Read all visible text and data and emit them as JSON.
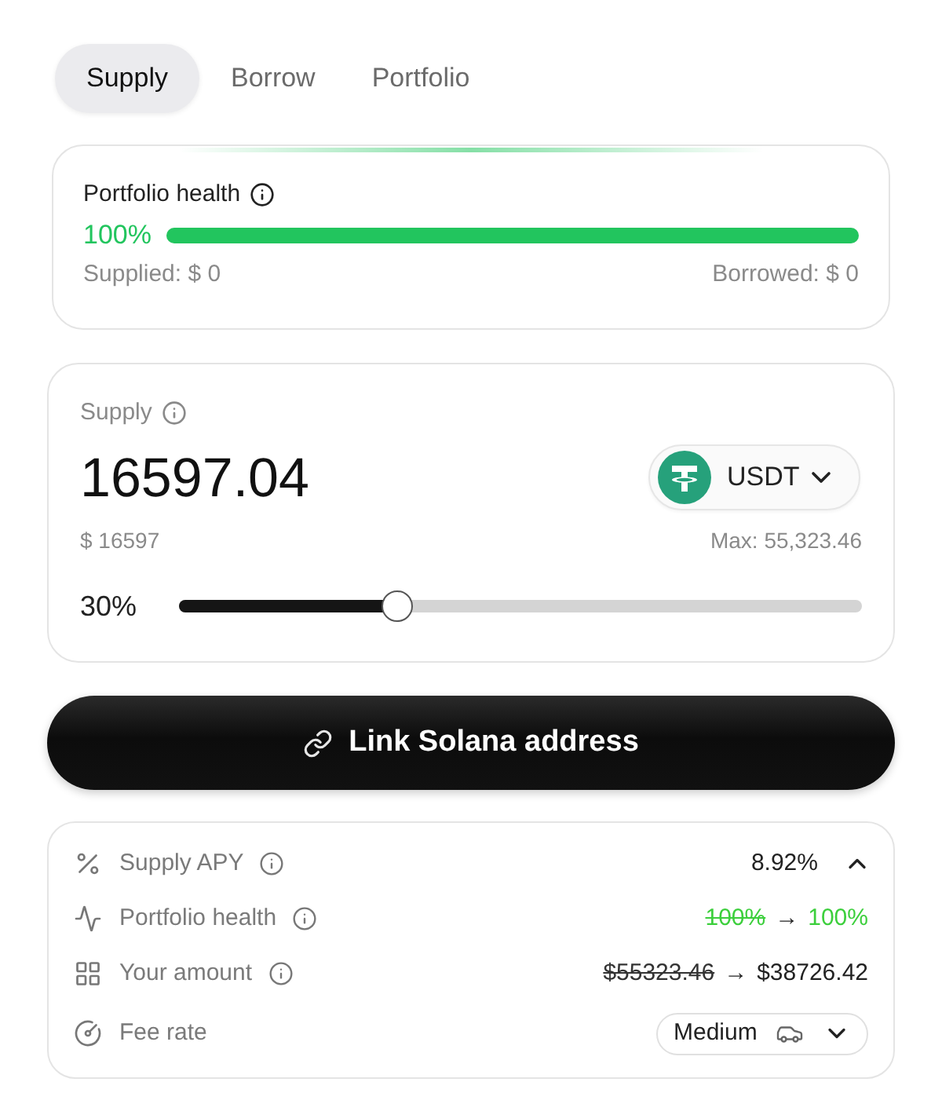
{
  "tabs": [
    {
      "label": "Supply",
      "selected": true
    },
    {
      "label": "Borrow",
      "selected": false
    },
    {
      "label": "Portfolio",
      "selected": false
    }
  ],
  "health_card": {
    "title": "Portfolio health",
    "percent": "100%",
    "level": 1,
    "supplied": "Supplied: $ 0",
    "borrowed": "Borrowed: $ 0"
  },
  "supply_card": {
    "label": "Supply",
    "amount": "16597.04",
    "token": "USDT",
    "usd_value": "$ 16597",
    "max": "Max: 55,323.46",
    "slider": {
      "reading": "30%",
      "level": 0.31
    }
  },
  "action_button": {
    "label": "Link Solana address"
  },
  "details": {
    "rows": [
      {
        "kind": "value",
        "label": "Supply APY",
        "info": true,
        "value": "8.92%",
        "expanded": true
      },
      {
        "kind": "change",
        "label": "Portfolio health",
        "info": true,
        "from": "100%",
        "arrow": "→",
        "to": "100%",
        "highlight": true
      },
      {
        "kind": "change",
        "label": "Your amount",
        "info": true,
        "from": "$55323.46",
        "arrow": "→",
        "to": "$38726.42",
        "highlight": false
      },
      {
        "kind": "select",
        "label": "Fee rate",
        "info": false,
        "value": "Medium"
      }
    ]
  }
}
